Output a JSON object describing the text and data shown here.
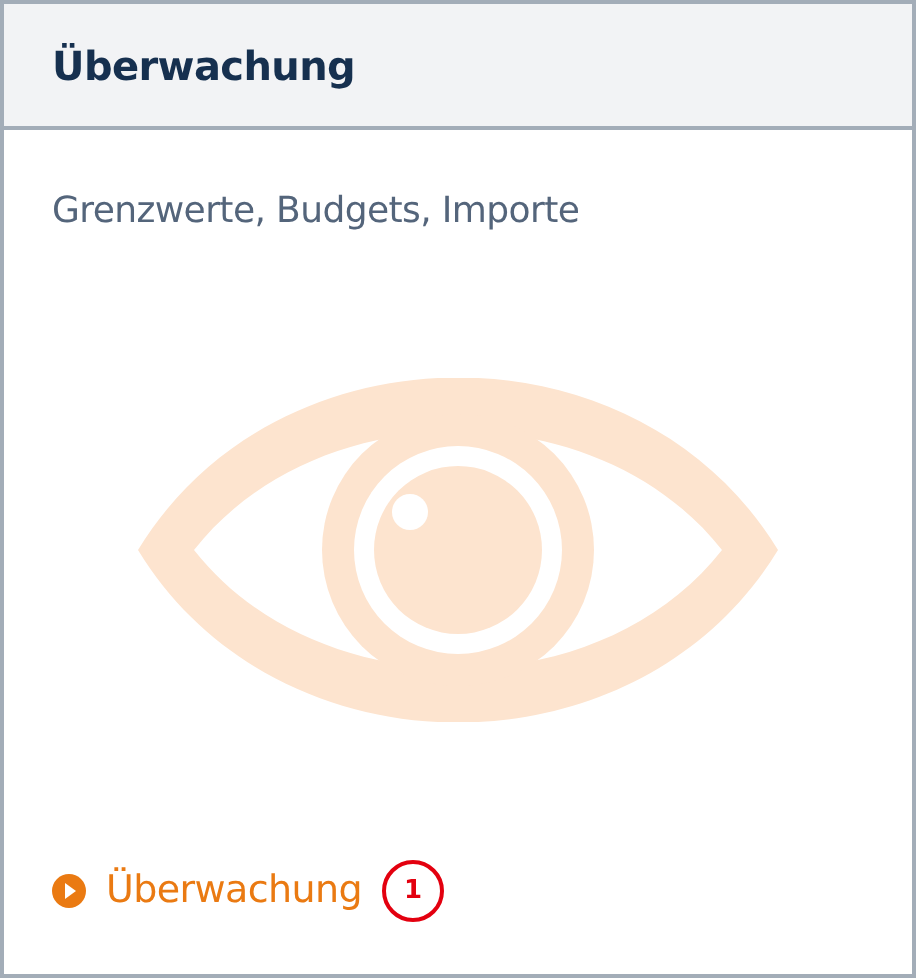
{
  "card": {
    "title": "Überwachung",
    "description": "Grenzwerte, Budgets, Importe",
    "link": {
      "label": "Überwachung"
    },
    "annotation": {
      "label": "1"
    }
  }
}
